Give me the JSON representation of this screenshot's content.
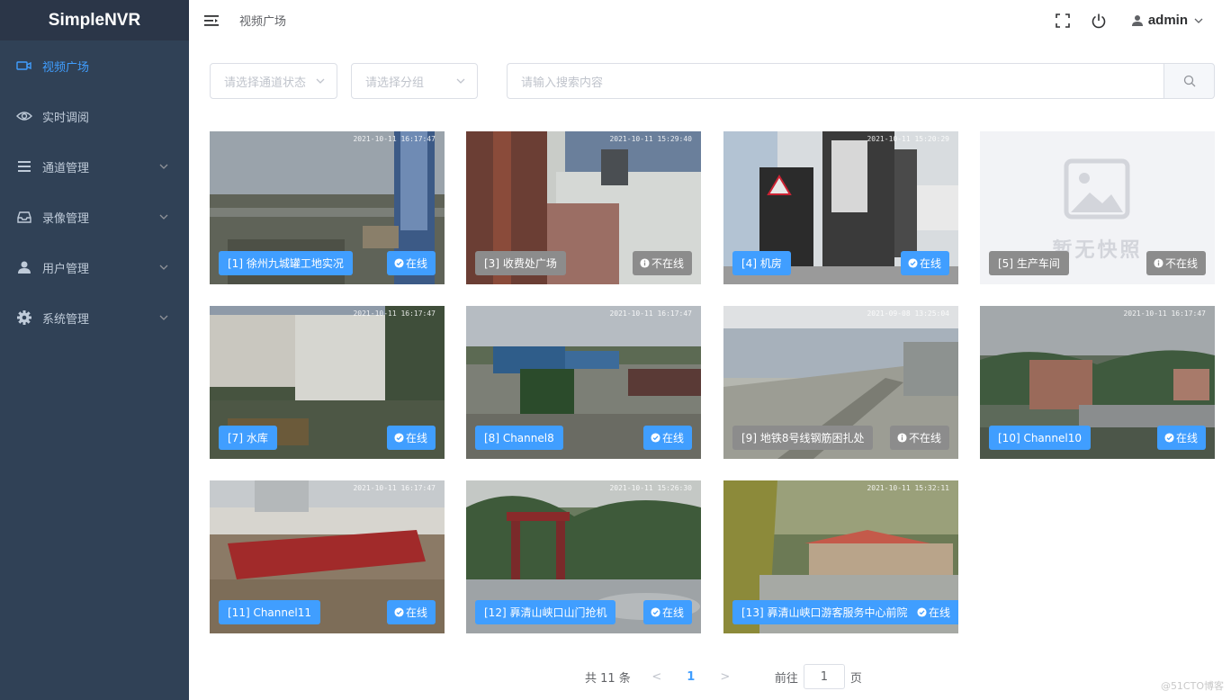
{
  "app": {
    "brand": "SimpleNVR"
  },
  "sidebar": {
    "items": [
      {
        "label": "视频广场",
        "icon": "video-camera-icon",
        "active": true,
        "has_sub": false
      },
      {
        "label": "实时调阅",
        "icon": "eye-icon",
        "active": false,
        "has_sub": false
      },
      {
        "label": "通道管理",
        "icon": "list-icon",
        "active": false,
        "has_sub": true
      },
      {
        "label": "录像管理",
        "icon": "inbox-icon",
        "active": false,
        "has_sub": true
      },
      {
        "label": "用户管理",
        "icon": "user-icon",
        "active": false,
        "has_sub": true
      },
      {
        "label": "系统管理",
        "icon": "gear-icon",
        "active": false,
        "has_sub": true
      }
    ]
  },
  "header": {
    "breadcrumb": "视频广场",
    "username": "admin"
  },
  "filters": {
    "status_placeholder": "请选择通道状态",
    "group_placeholder": "请选择分组",
    "search_placeholder": "请输入搜索内容"
  },
  "cards": [
    {
      "name": "[1] 徐州九城罐工地实况",
      "status": "在线",
      "online": true,
      "ts": "2021-10-11 16:17:47"
    },
    {
      "name": "[3] 收费处广场",
      "status": "不在线",
      "online": false,
      "ts": "2021-10-11 15:29:40"
    },
    {
      "name": "[4] 机房",
      "status": "在线",
      "online": true,
      "ts": "2021-10-11 15:20:29"
    },
    {
      "name": "[5] 生产车间",
      "status": "不在线",
      "online": false,
      "ts": "",
      "placeholder_text": "暂无快照"
    },
    {
      "name": "[7] 水库",
      "status": "在线",
      "online": true,
      "ts": "2021-10-11 16:17:47"
    },
    {
      "name": "[8] Channel8",
      "status": "在线",
      "online": true,
      "ts": "2021-10-11 16:17:47"
    },
    {
      "name": "[9] 地铁8号线钢筋困扎处",
      "status": "不在线",
      "online": false,
      "ts": "2021-09-08 13:25:04"
    },
    {
      "name": "[10] Channel10",
      "status": "在线",
      "online": true,
      "ts": "2021-10-11 16:17:47"
    },
    {
      "name": "[11] Channel11",
      "status": "在线",
      "online": true,
      "ts": "2021-10-11 16:17:47"
    },
    {
      "name": "[12] 奡清山峡口山门抢机",
      "status": "在线",
      "online": true,
      "ts": "2021-10-11 15:26:30"
    },
    {
      "name": "[13] 奡清山峡口游客服务中心前院",
      "status": "在线",
      "online": true,
      "ts": "2021-10-11 15:32:11"
    }
  ],
  "pagination": {
    "total_text": "共 11 条",
    "prev": "<",
    "current": "1",
    "next": ">",
    "goto_label": "前往",
    "goto_value": "1",
    "page_suffix": "页"
  },
  "watermark": "@51CTO博客",
  "colors": {
    "sidebar": "#304156",
    "accent": "#409eff",
    "offline": "#8c8c8c"
  }
}
